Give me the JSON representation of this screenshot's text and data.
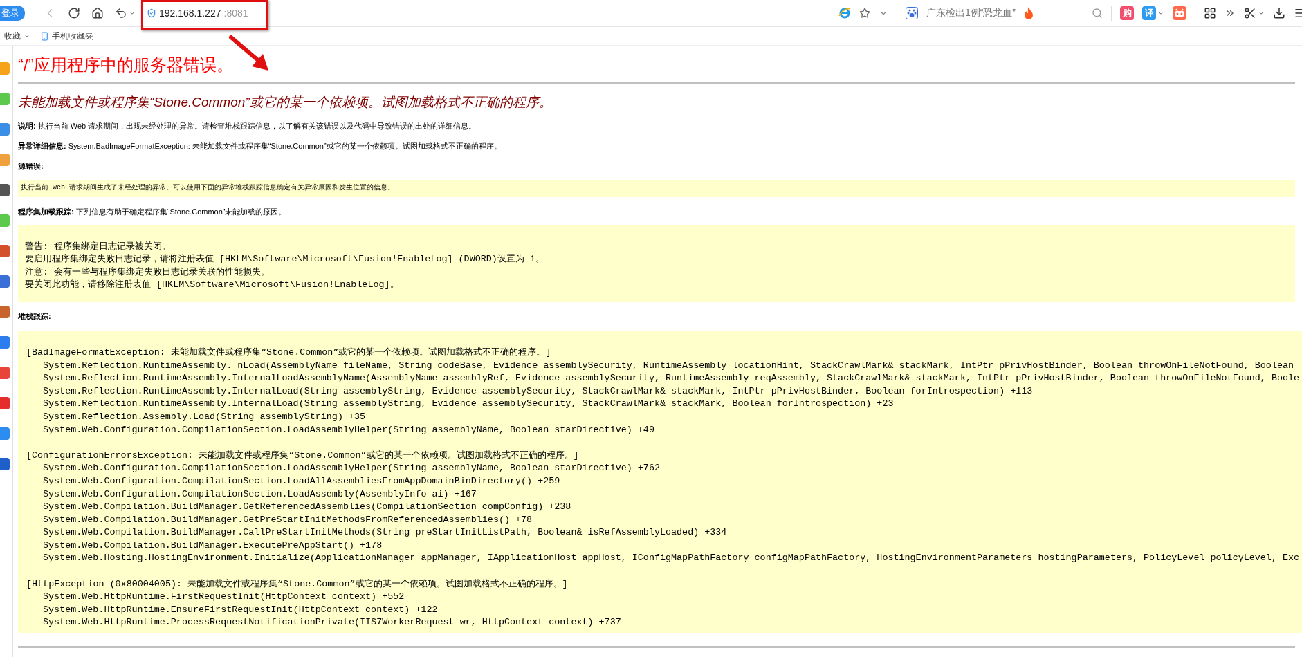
{
  "browser": {
    "login_button": "登录",
    "address": {
      "host": "192.168.1.227",
      "port": ":8081"
    },
    "news": "广东检出1例“恐龙血”",
    "badges": [
      {
        "label": "购",
        "color": "#f0506e",
        "caret": false
      },
      {
        "label": "译",
        "color": "#2d9cf0",
        "caret": true
      }
    ],
    "bookmarks": [
      {
        "label": "收藏",
        "kind": "menu"
      },
      {
        "label": "手机收藏夹",
        "kind": "link"
      }
    ]
  },
  "page": {
    "title": "“/”应用程序中的服务器错误。",
    "subtitle": "未能加载文件或程序集“Stone.Common”或它的某一个依赖项。试图加载格式不正确的程序。",
    "fields": [
      {
        "label": "说明:",
        "text": "执行当前 Web 请求期间，出现未经处理的异常。请检查堆栈跟踪信息，以了解有关该错误以及代码中导致错误的出处的详细信息。"
      },
      {
        "label": "异常详细信息:",
        "text": "System.BadImageFormatException: 未能加载文件或程序集“Stone.Common”或它的某一个依赖项。试图加载格式不正确的程序。"
      }
    ],
    "source_error": {
      "label": "源错误:",
      "text": "执行当前 Web 请求期间生成了未经处理的异常。可以使用下面的异常堆栈跟踪信息确定有关异常原因和发生位置的信息。"
    },
    "assembly_trace": {
      "label": "程序集加载跟踪:",
      "text": "下列信息有助于确定程序集“Stone.Common”未能加载的原因。",
      "lines": [
        "警告: 程序集绑定日志记录被关闭。",
        "要启用程序集绑定失败日志记录，请将注册表值 [HKLM\\Software\\Microsoft\\Fusion!EnableLog] (DWORD)设置为 1。",
        "注意: 会有一些与程序集绑定失败日志记录关联的性能损失。",
        "要关闭此功能，请移除注册表值 [HKLM\\Software\\Microsoft\\Fusion!EnableLog]。"
      ]
    },
    "stack_trace": {
      "label": "堆栈跟踪:",
      "blocks": [
        {
          "header": "[BadImageFormatException: 未能加载文件或程序集“Stone.Common”或它的某一个依赖项。试图加载格式不正确的程序。]",
          "frames": [
            "System.Reflection.RuntimeAssembly._nLoad(AssemblyName fileName, String codeBase, Evidence assemblySecurity, RuntimeAssembly locationHint, StackCrawlMark& stackMark, IntPtr pPrivHostBinder, Boolean throwOnFileNotFound, Boolean",
            "System.Reflection.RuntimeAssembly.InternalLoadAssemblyName(AssemblyName assemblyRef, Evidence assemblySecurity, RuntimeAssembly reqAssembly, StackCrawlMark& stackMark, IntPtr pPrivHostBinder, Boolean throwOnFileNotFound, Boole",
            "System.Reflection.RuntimeAssembly.InternalLoad(String assemblyString, Evidence assemblySecurity, StackCrawlMark& stackMark, IntPtr pPrivHostBinder, Boolean forIntrospection) +113",
            "System.Reflection.RuntimeAssembly.InternalLoad(String assemblyString, Evidence assemblySecurity, StackCrawlMark& stackMark, Boolean forIntrospection) +23",
            "System.Reflection.Assembly.Load(String assemblyString) +35",
            "System.Web.Configuration.CompilationSection.LoadAssemblyHelper(String assemblyName, Boolean starDirective) +49"
          ]
        },
        {
          "header": "[ConfigurationErrorsException: 未能加载文件或程序集“Stone.Common”或它的某一个依赖项。试图加载格式不正确的程序。]",
          "frames": [
            "System.Web.Configuration.CompilationSection.LoadAssemblyHelper(String assemblyName, Boolean starDirective) +762",
            "System.Web.Configuration.CompilationSection.LoadAllAssembliesFromAppDomainBinDirectory() +259",
            "System.Web.Configuration.CompilationSection.LoadAssembly(AssemblyInfo ai) +167",
            "System.Web.Compilation.BuildManager.GetReferencedAssemblies(CompilationSection compConfig) +238",
            "System.Web.Compilation.BuildManager.GetPreStartInitMethodsFromReferencedAssemblies() +78",
            "System.Web.Compilation.BuildManager.CallPreStartInitMethods(String preStartInitListPath, Boolean& isRefAssemblyLoaded) +334",
            "System.Web.Compilation.BuildManager.ExecutePreAppStart() +178",
            "System.Web.Hosting.HostingEnvironment.Initialize(ApplicationManager appManager, IApplicationHost appHost, IConfigMapPathFactory configMapPathFactory, HostingEnvironmentParameters hostingParameters, PolicyLevel policyLevel, Exc"
          ]
        },
        {
          "header": "[HttpException (0x80004005): 未能加载文件或程序集“Stone.Common”或它的某一个依赖项。试图加载格式不正确的程序。]",
          "frames": [
            "System.Web.HttpRuntime.FirstRequestInit(HttpContext context) +552",
            "System.Web.HttpRuntime.EnsureFirstRequestInit(HttpContext context) +122",
            "System.Web.HttpRuntime.ProcessRequestNotificationPrivate(IIS7WorkerRequest wr, HttpContext context) +737"
          ]
        }
      ]
    }
  }
}
